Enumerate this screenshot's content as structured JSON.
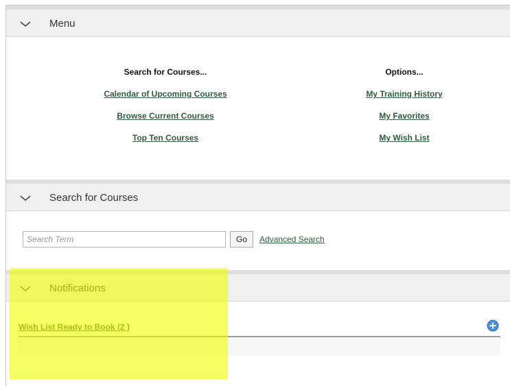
{
  "menu_panel": {
    "title": "Menu",
    "left_column": {
      "heading": "Search for Courses...",
      "links": [
        "Calendar of Upcoming Courses",
        "Browse Current Courses",
        "Top Ten Courses"
      ]
    },
    "right_column": {
      "heading": "Options...",
      "links": [
        "My Training History",
        "My Favorites",
        "My Wish List"
      ]
    }
  },
  "search_panel": {
    "title": "Search for Courses",
    "input_placeholder": "Search Term",
    "go_label": "Go",
    "advanced_label": "Advanced Search"
  },
  "notifications_panel": {
    "title": "Notifications",
    "item_label": "Wish List Ready to Book (2 )"
  },
  "icons": {
    "chevron": "chevron-down-icon",
    "add": "plus-circle-icon"
  },
  "colors": {
    "link": "#2e5d3b",
    "panel_header_bg": "#f0f0f0",
    "highlight": "#f0ff00",
    "add_icon": "#4a90d9"
  }
}
